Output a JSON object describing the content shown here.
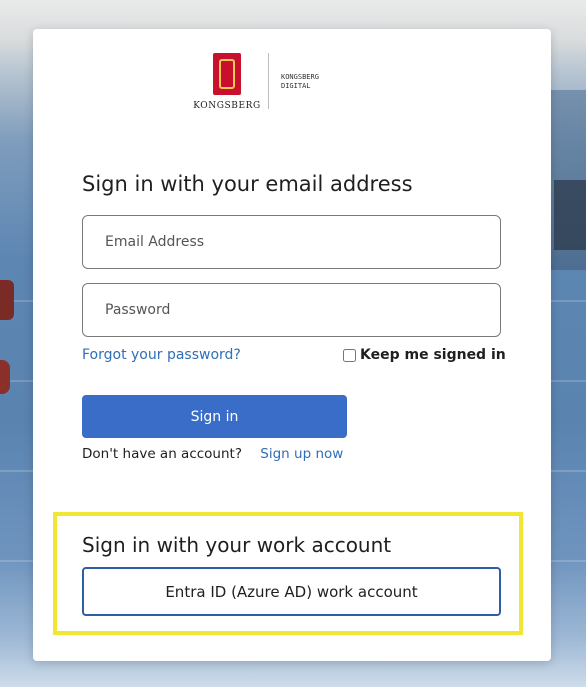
{
  "logo": {
    "wordmark": "KONGSBERG",
    "digital_line1": "KONGSBERG",
    "digital_line2": "DIGITAL"
  },
  "email_section": {
    "title": "Sign in with your email address",
    "email_placeholder": "Email Address",
    "password_placeholder": "Password",
    "forgot_label": "Forgot your password?",
    "keep_signed_in_label": "Keep me signed in",
    "signin_label": "Sign in",
    "no_account_text": "Don't have an account?",
    "signup_label": "Sign up now"
  },
  "work_section": {
    "title": "Sign in with your work account",
    "button_label": "Entra ID (Azure AD) work account"
  },
  "colors": {
    "primary_button": "#3a6dc8",
    "link": "#2f6fb5",
    "highlight": "#f1e633",
    "brand_red": "#c8102e"
  }
}
